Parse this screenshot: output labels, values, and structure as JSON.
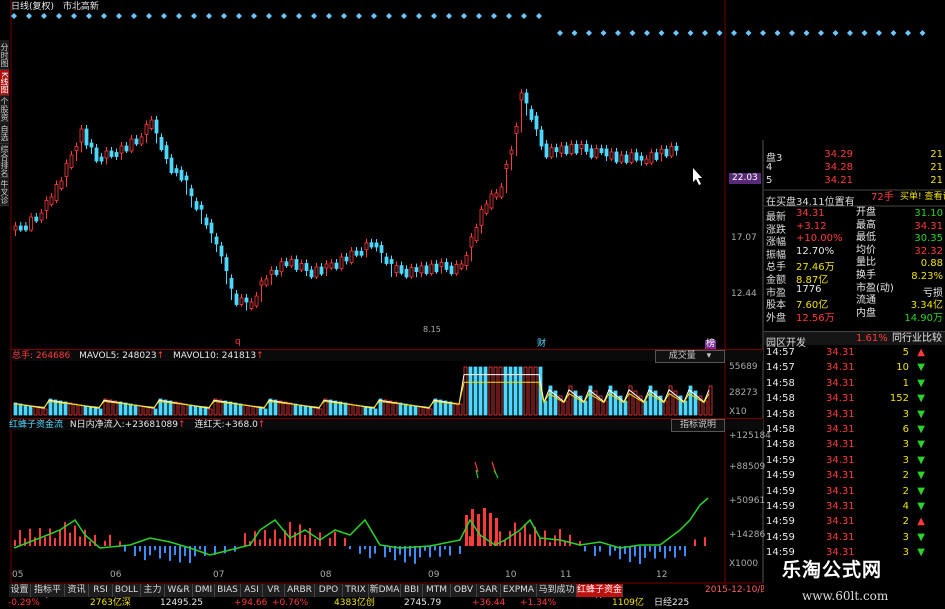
{
  "header": {
    "title": "日线(复权)",
    "indicator": "市北高新"
  },
  "left_tabs": [
    {
      "label": "分时图",
      "active": false
    },
    {
      "label": "K线图",
      "active": true
    },
    {
      "label": "个股资料",
      "active": false
    },
    {
      "label": "自选股",
      "active": false
    },
    {
      "label": "综合排名",
      "active": false
    },
    {
      "label": "牛叉诊股",
      "active": false
    }
  ],
  "price_axis": [
    "22.03",
    "17.07",
    "12.44"
  ],
  "price_labels": {
    "low_marker": "8.15",
    "low_label": "q",
    "event_labels": [
      "财",
      "榜"
    ]
  },
  "volume_panel": {
    "heading_prefix": "总手: ",
    "total": "264686",
    "mavol5_label": "MAVOL5: ",
    "mavol5": "248023",
    "mavol10_label": "MAVOL10: ",
    "mavol10": "241813",
    "select_value": "成交量",
    "axis": [
      "55689",
      "28273",
      "X10"
    ]
  },
  "flow_panel": {
    "heading": "红蜂子资金流",
    "n_label": "N日内净流入:",
    "n_value": "+23681089",
    "days_label": "连红天:",
    "days_value": "+368.0",
    "help": "指标说明",
    "axis": [
      "+125184",
      "+88509",
      "+50961",
      "+14286",
      "X1000"
    ]
  },
  "x_axis": [
    "05",
    "06",
    "07",
    "08",
    "09",
    "10",
    "11",
    "12"
  ],
  "order_book": [
    {
      "label": "盘3",
      "price": "34.29",
      "vol": "21"
    },
    {
      "label": "4",
      "price": "34.28",
      "vol": "21"
    },
    {
      "label": "5",
      "price": "34.21",
      "vol": "21"
    }
  ],
  "book_banner": {
    "text": "在买盘34.11位置有",
    "hands": "72手",
    "link": "买单! 查看详细"
  },
  "quote": [
    {
      "k1": "最新",
      "v1": "34.31",
      "k2": "开盘",
      "v2": "31.10",
      "c1": "red",
      "c2": "green"
    },
    {
      "k1": "涨跌",
      "v1": "+3.12",
      "k2": "最高",
      "v2": "34.31",
      "c1": "red",
      "c2": "red"
    },
    {
      "k1": "涨幅",
      "v1": "+10.00%",
      "k2": "最低",
      "v2": "30.35",
      "c1": "red",
      "c2": "green"
    },
    {
      "k1": "振幅",
      "v1": "12.70%",
      "k2": "均价",
      "v2": "32.32",
      "c1": "white",
      "c2": "red"
    },
    {
      "k1": "总手",
      "v1": "27.46万",
      "k2": "量比",
      "v2": "0.88",
      "c1": "yellow",
      "c2": "yellow"
    },
    {
      "k1": "金额",
      "v1": "8.87亿",
      "k2": "换手",
      "v2": "8.23%",
      "c1": "yellow",
      "c2": "yellow"
    },
    {
      "k1": "市盈",
      "v1": "1776",
      "k2": "市盈(动)",
      "v2": "亏损",
      "c1": "white",
      "c2": "white"
    },
    {
      "k1": "股本",
      "v1": "7.60亿",
      "k2": "流通",
      "v2": "3.34亿",
      "c1": "yellow",
      "c2": "yellow"
    },
    {
      "k1": "外盘",
      "v1": "12.56万",
      "k2": "内盘",
      "v2": "14.90万",
      "c1": "red",
      "c2": "green"
    }
  ],
  "sector": {
    "name": "园区开发",
    "change": "1.61%",
    "compare": "同行业比较"
  },
  "trades": [
    {
      "time": "14:57",
      "price": "34.31",
      "vol": "5",
      "dir": "up"
    },
    {
      "time": "14:57",
      "price": "34.31",
      "vol": "10",
      "dir": "down"
    },
    {
      "time": "14:58",
      "price": "34.31",
      "vol": "1",
      "dir": "down"
    },
    {
      "time": "14:58",
      "price": "34.31",
      "vol": "152",
      "dir": "down"
    },
    {
      "time": "14:58",
      "price": "34.31",
      "vol": "3",
      "dir": "down"
    },
    {
      "time": "14:58",
      "price": "34.31",
      "vol": "6",
      "dir": "down"
    },
    {
      "time": "14:58",
      "price": "34.31",
      "vol": "3",
      "dir": "down"
    },
    {
      "time": "14:59",
      "price": "34.31",
      "vol": "3",
      "dir": "down"
    },
    {
      "time": "14:59",
      "price": "34.31",
      "vol": "2",
      "dir": "down"
    },
    {
      "time": "14:59",
      "price": "34.31",
      "vol": "2",
      "dir": "down"
    },
    {
      "time": "14:59",
      "price": "34.31",
      "vol": "4",
      "dir": "down"
    },
    {
      "time": "14:59",
      "price": "34.31",
      "vol": "2",
      "dir": "up"
    },
    {
      "time": "14:59",
      "price": "34.31",
      "vol": "3",
      "dir": "down"
    },
    {
      "time": "14:59",
      "price": "34.31",
      "vol": "3",
      "dir": "down"
    }
  ],
  "bottom_tabs": [
    {
      "label": "设置",
      "active": false
    },
    {
      "label": "指标平台",
      "active": false
    },
    {
      "label": "资讯",
      "active": false
    },
    {
      "label": "RSI",
      "active": false
    },
    {
      "label": "BOLL",
      "active": false
    },
    {
      "label": "主力",
      "active": false
    },
    {
      "label": "W&R",
      "active": false
    },
    {
      "label": "DMI",
      "active": false
    },
    {
      "label": "BIAS",
      "active": false
    },
    {
      "label": "ASI",
      "active": false
    },
    {
      "label": "VR",
      "active": false
    },
    {
      "label": "ARBR",
      "active": false
    },
    {
      "label": "DPO",
      "active": false
    },
    {
      "label": "TRIX",
      "active": false
    },
    {
      "label": "新DMA",
      "active": false
    },
    {
      "label": "BBI",
      "active": false
    },
    {
      "label": "MTM",
      "active": false
    },
    {
      "label": "OBV",
      "active": false
    },
    {
      "label": "SAR",
      "active": false
    },
    {
      "label": "EXPMA",
      "active": false
    },
    {
      "label": "马到成功",
      "active": false
    },
    {
      "label": "红蜂子资金流",
      "active": true
    }
  ],
  "bottom_date": "2015-12-10/四",
  "status_bar": {
    "items": [
      "-0.29%",
      "2763亿深",
      "12495.25",
      "+94.66",
      "+0.76%",
      "4383亿创",
      "2745.79",
      "+36.44",
      "+1.34%",
      "1109亿",
      "日经225"
    ]
  },
  "watermark": {
    "cn": "乐淘公式网",
    "url": "www.60lt.com"
  },
  "colors": {
    "up": "#ff3a3a",
    "down": "#4fd8ff",
    "bg": "#000000",
    "active_tab": "#c01010",
    "flow_line": "#29d329"
  }
}
